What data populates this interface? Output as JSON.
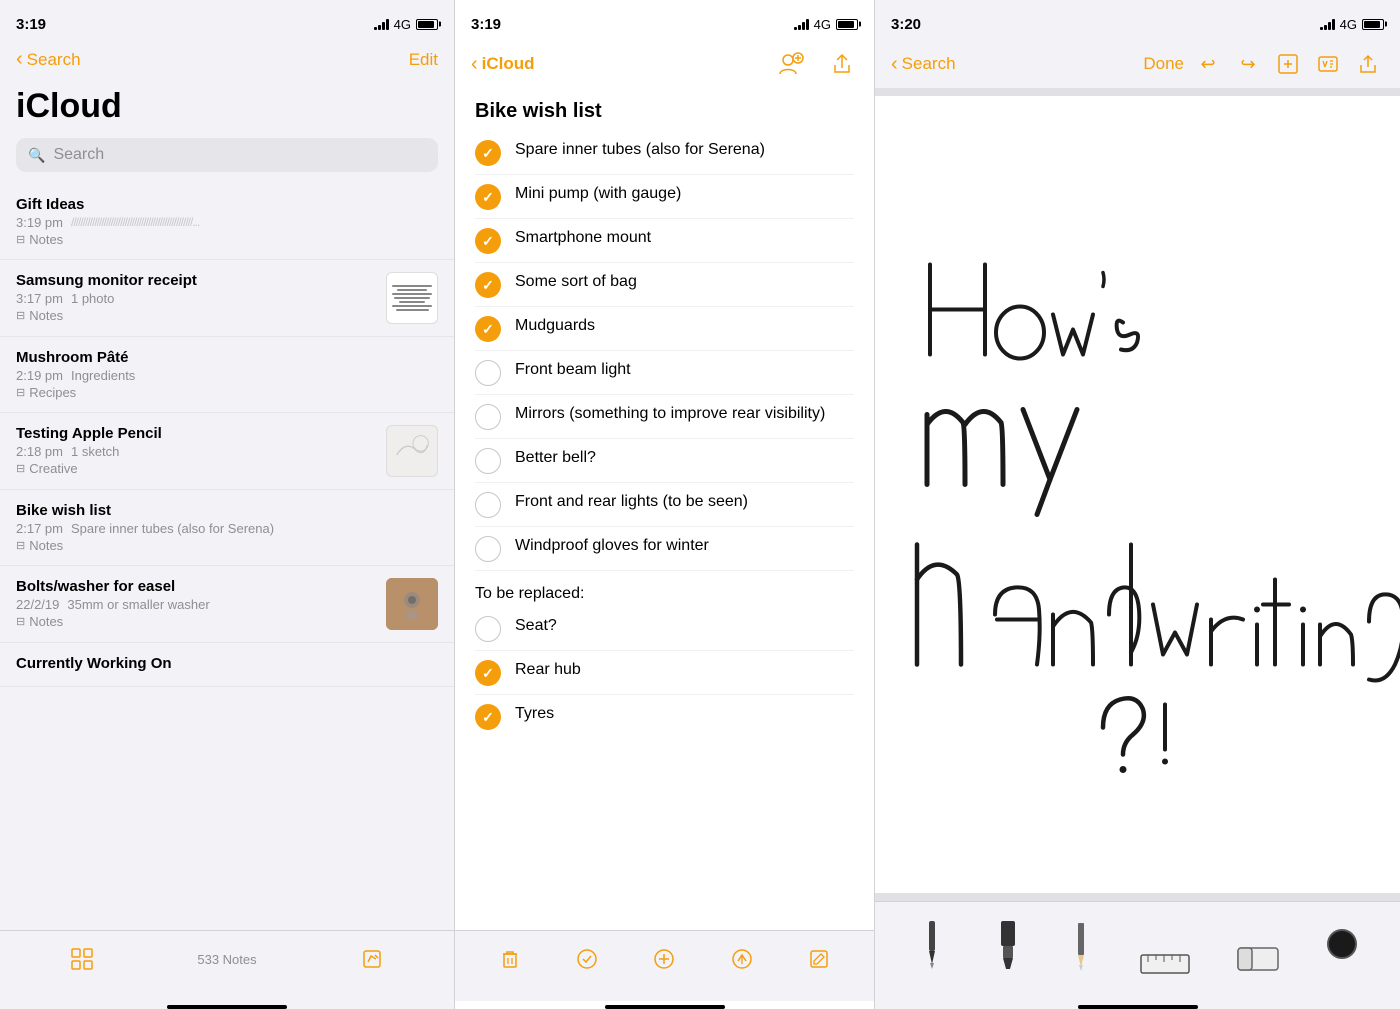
{
  "leftPanel": {
    "statusBar": {
      "time": "3:19",
      "signal": "4G",
      "backLabel": "Search"
    },
    "title": "iCloud",
    "search": {
      "placeholder": "Search"
    },
    "notes": [
      {
        "title": "Gift Ideas",
        "time": "3:19 pm",
        "preview": "////////////////////////////////////////////////////...",
        "folder": "Notes",
        "hasThumb": false
      },
      {
        "title": "Samsung monitor receipt",
        "time": "3:17 pm",
        "preview": "1 photo",
        "folder": "Notes",
        "hasThumb": true,
        "thumbType": "receipt"
      },
      {
        "title": "Mushroom Pâté",
        "time": "2:19 pm",
        "preview": "Ingredients",
        "folder": "Recipes",
        "hasThumb": false
      },
      {
        "title": "Testing Apple Pencil",
        "time": "2:18 pm",
        "preview": "1 sketch",
        "folder": "Creative",
        "hasThumb": true,
        "thumbType": "sketch"
      },
      {
        "title": "Bike wish list",
        "time": "2:17 pm",
        "preview": "Spare inner tubes (also for Serena)",
        "folder": "Notes",
        "hasThumb": false
      },
      {
        "title": "Bolts/washer for easel",
        "time": "22/2/19",
        "preview": "35mm or smaller washer",
        "folder": "Notes",
        "hasThumb": true,
        "thumbType": "photo"
      },
      {
        "title": "Currently Working On",
        "time": "",
        "preview": "",
        "folder": "",
        "hasThumb": false,
        "partial": true
      }
    ],
    "bottomBar": {
      "count": "533 Notes"
    }
  },
  "middlePanel": {
    "statusBar": {
      "time": "3:19",
      "signal": "4G",
      "backLabel": "iCloud"
    },
    "noteTitle": "Bike wish list",
    "checkedItems": [
      "Spare inner tubes (also for Serena)",
      "Mini pump (with gauge)",
      "Smartphone mount",
      "Some sort of bag",
      "Mudguards"
    ],
    "uncheckedItems": [
      "Front beam light",
      "Mirrors (something to improve rear visibility)",
      "Better bell?",
      "Front and rear lights (to be seen)",
      "Windproof gloves for winter"
    ],
    "sectionLabel": "To be replaced:",
    "replacedUnchecked": [
      "Seat?"
    ],
    "replacedChecked": [
      "Rear hub",
      "Tyres"
    ]
  },
  "rightPanel": {
    "statusBar": {
      "time": "3:20",
      "signal": "4G",
      "backLabel": "Search"
    },
    "doneLabel": "Done",
    "handwritingText": "How's my handwriting?",
    "tools": [
      {
        "name": "pen",
        "label": "Pen"
      },
      {
        "name": "marker",
        "label": "Marker"
      },
      {
        "name": "pencil",
        "label": "Pencil"
      },
      {
        "name": "ruler",
        "label": "Ruler"
      },
      {
        "name": "eraser",
        "label": "Eraser"
      },
      {
        "name": "color",
        "label": "Color"
      }
    ]
  },
  "icons": {
    "back": "‹",
    "folder": "⊟",
    "checkmark": "✓",
    "search": "⌕",
    "grid": "⊞",
    "compose": "✎",
    "trash": "⌫",
    "circle": "○",
    "plus": "+",
    "send": "↑",
    "share": "↑",
    "addPerson": "👤",
    "undo": "↩",
    "redo": "↪",
    "addNote": "⊞",
    "format": "⊟"
  },
  "colors": {
    "accent": "#f59e0b",
    "text": "#000",
    "secondary": "#8e8e93",
    "border": "#e5e5ea",
    "background": "#f2f2f7"
  }
}
